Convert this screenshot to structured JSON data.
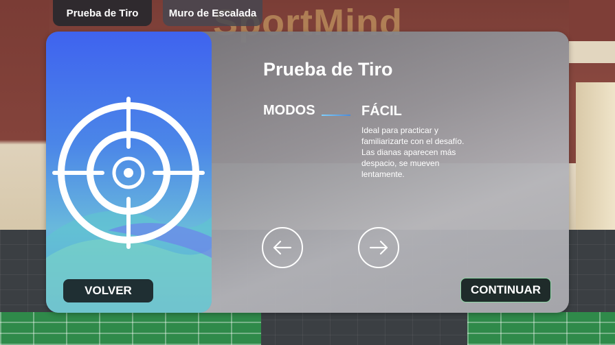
{
  "tabs": [
    {
      "label": "Prueba de Tiro",
      "active": true
    },
    {
      "label": "Muro de Escalada",
      "active": false
    }
  ],
  "background": {
    "sign_text": "SportMind"
  },
  "panel": {
    "title": "Prueba de Tiro",
    "modes_label": "MODOS",
    "mode_name": "FÁCIL",
    "mode_description": "Ideal para practicar y familiarizarte con el desafío. Las dianas aparecen más despacio, se mueven lentamente.",
    "hero_icon": "crosshair-target-icon",
    "prev_icon": "arrow-left-icon",
    "next_icon": "arrow-right-icon",
    "back_label": "VOLVER",
    "continue_label": "CONTINUAR"
  },
  "colors": {
    "hero_top": "#3f63ef",
    "hero_mid": "#69b9dc",
    "continue_border": "#8fd7a6",
    "button_dark": "#1f2f33"
  }
}
